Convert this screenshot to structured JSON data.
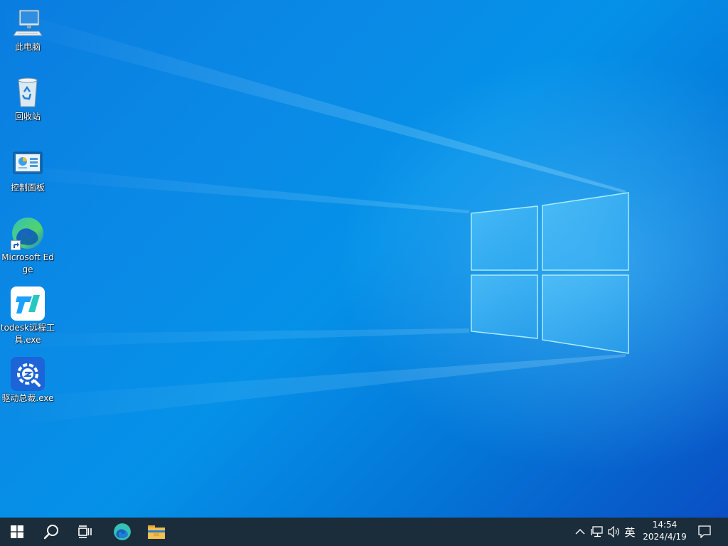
{
  "desktop": {
    "icons": [
      {
        "name": "此电脑",
        "icon": "computer-icon"
      },
      {
        "name": "回收站",
        "icon": "recycle-bin-icon"
      },
      {
        "name": "控制面板",
        "icon": "control-panel-icon"
      },
      {
        "name": "Microsoft Edge",
        "icon": "edge-icon"
      },
      {
        "name": "todesk远程工具.exe",
        "icon": "todesk-icon"
      },
      {
        "name": "驱动总裁.exe",
        "icon": "driver-tool-icon"
      }
    ]
  },
  "taskbar": {
    "start": "start-icon",
    "search": "search-icon",
    "task_view": "task-view-icon",
    "pinned": [
      "edge-icon",
      "file-explorer-icon"
    ],
    "tray": {
      "chevron": "chevron-up-icon",
      "network": "network-icon",
      "volume": "volume-icon",
      "ime": "英",
      "time": "14:54",
      "date": "2024/4/19",
      "notifications": "notification-icon"
    }
  },
  "colors": {
    "desktop_accent": "#0a7de0",
    "taskbar": "#14263a",
    "edge_teal": "#35c1b6",
    "edge_blue": "#1f7ed6",
    "todesk_blue": "#1aa0ff",
    "explorer_yellow": "#f3c04f"
  }
}
